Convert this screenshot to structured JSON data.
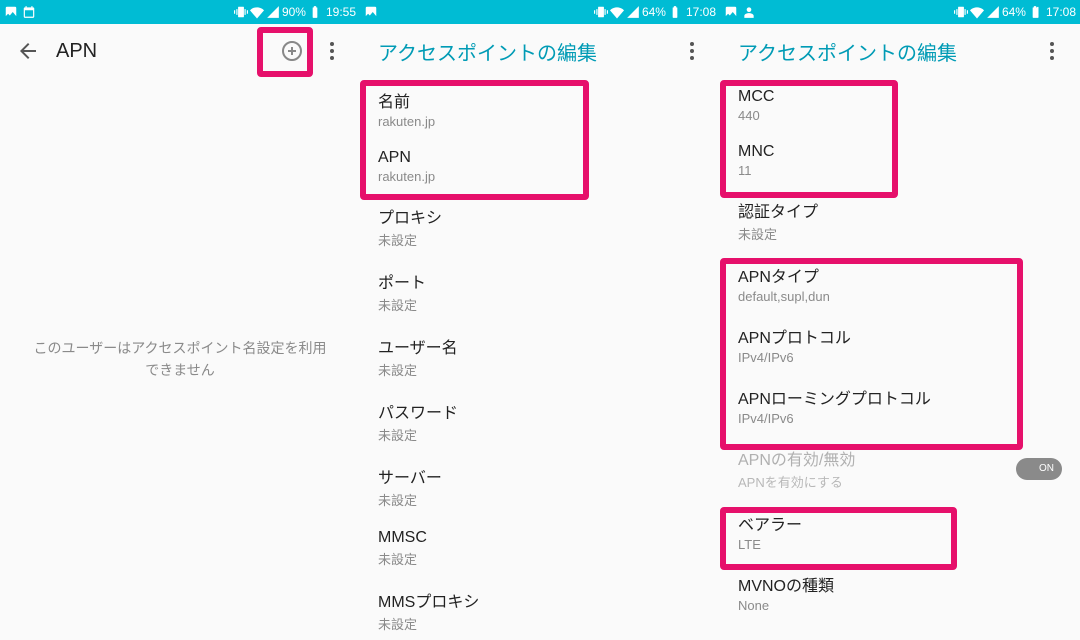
{
  "panel1": {
    "status": {
      "batt": "90%",
      "time": "19:55"
    },
    "title": "APN",
    "empty_message": "このユーザーはアクセスポイント名設定を利用\nできません"
  },
  "panel2": {
    "status": {
      "batt": "64%",
      "time": "17:08"
    },
    "title": "アクセスポイントの編集",
    "items": [
      {
        "t": "名前",
        "v": "rakuten.jp"
      },
      {
        "t": "APN",
        "v": "rakuten.jp"
      },
      {
        "t": "プロキシ",
        "v": "未設定"
      },
      {
        "t": "ポート",
        "v": "未設定"
      },
      {
        "t": "ユーザー名",
        "v": "未設定"
      },
      {
        "t": "パスワード",
        "v": "未設定"
      },
      {
        "t": "サーバー",
        "v": "未設定"
      },
      {
        "t": "MMSC",
        "v": "未設定"
      },
      {
        "t": "MMSプロキシ",
        "v": "未設定"
      }
    ]
  },
  "panel3": {
    "status": {
      "batt": "64%",
      "time": "17:08"
    },
    "title": "アクセスポイントの編集",
    "items_a": [
      {
        "t": "MCC",
        "v": "440"
      },
      {
        "t": "MNC",
        "v": "11"
      },
      {
        "t": "認証タイプ",
        "v": "未設定"
      },
      {
        "t": "APNタイプ",
        "v": "default,supl,dun"
      },
      {
        "t": "APNプロトコル",
        "v": "IPv4/IPv6"
      },
      {
        "t": "APNローミングプロトコル",
        "v": "IPv4/IPv6"
      }
    ],
    "toggle": {
      "t": "APNの有効/無効",
      "sub": "APNを有効にする",
      "state": "ON"
    },
    "items_b": [
      {
        "t": "ベアラー",
        "v": "LTE"
      },
      {
        "t": "MVNOの種類",
        "v": "None"
      }
    ]
  }
}
